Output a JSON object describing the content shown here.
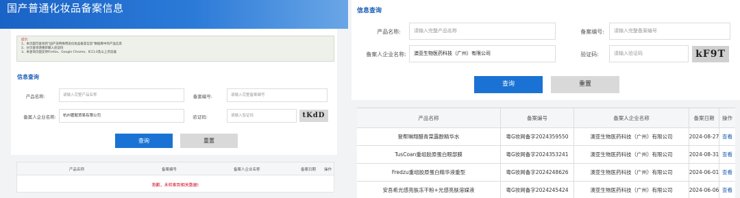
{
  "left": {
    "banner_title": "国产普通化妆品备案信息",
    "notice": {
      "title": "提示:",
      "lines": [
        "1、本页面可查询到“国产非特殊用途化妆品备案信息”数据库中的产品信息",
        "2、分页查询请重新输入验证码",
        "3、本查询页面支持Firefox、Google Chrome、IE11.0及以上浏览器"
      ]
    },
    "section_title": "信息查询",
    "form": {
      "product_label": "产品名称:",
      "product_placeholder": "请输入完整产品名称",
      "record_no_label": "备案编号:",
      "record_no_placeholder": "请输入完整备案编号",
      "company_label": "备案人企业名称:",
      "company_value": "杭州瞿懿贸易有限公司",
      "captcha_label": "验证码:",
      "captcha_placeholder": "请输入验证码",
      "captcha_text": "tKdD"
    },
    "buttons": {
      "search": "查询",
      "reset": "重置"
    },
    "table": {
      "headers": [
        "产品名称",
        "备案编号",
        "备案人企业名称",
        "备案日期",
        "操作"
      ],
      "empty_message": "抱歉，未检索到相关数据!"
    }
  },
  "right": {
    "section_title": "信息查询",
    "form": {
      "product_label": "产品名称:",
      "product_placeholder": "请输入完整产品名称",
      "record_no_label": "备案编号:",
      "record_no_placeholder": "请输入完整备案编号",
      "company_label": "备案人企业名称:",
      "company_value": "澳亚生物医药科技（广州）有限公司",
      "captcha_label": "验证码:",
      "captcha_placeholder": "请输入验证码",
      "captcha_text": "kF9T"
    },
    "buttons": {
      "search": "查询",
      "reset": "重置"
    },
    "table": {
      "headers": [
        "产品名称",
        "备案编号",
        "备案人企业名称",
        "备案日期",
        "操作"
      ],
      "rows": [
        [
          "登帮琳翔醋青菜露酚精华水",
          "粤G妆网备字2024359550",
          "澳亚生物医药科技（广州）有限公司",
          "2024-08-27",
          "查看"
        ],
        [
          "TusCoan重组胶原蛋白眼部膜",
          "粤G妆网备字2024353241",
          "澳亚生物医药科技（广州）有限公司",
          "2024-08-31",
          "查看"
        ],
        [
          "Fredzu重组胶原蛋白精华液重型",
          "粤G妆网备字2024248626",
          "澳亚生物医药科技（广州）有限公司",
          "2024-06-01",
          "查看"
        ],
        [
          "安吾希光感亮肤冻干粉+光感亮肤溶媒液",
          "粤G妆网备字2024245424",
          "澳亚生物医药科技（广州）有限公司",
          "2024-06-06",
          "查看"
        ]
      ]
    }
  },
  "colors": {
    "primary": "#1a73d4",
    "banner": "#1a63c6",
    "heading": "#1a5eb5",
    "error": "#d0021b",
    "link": "#1a5eb5"
  }
}
